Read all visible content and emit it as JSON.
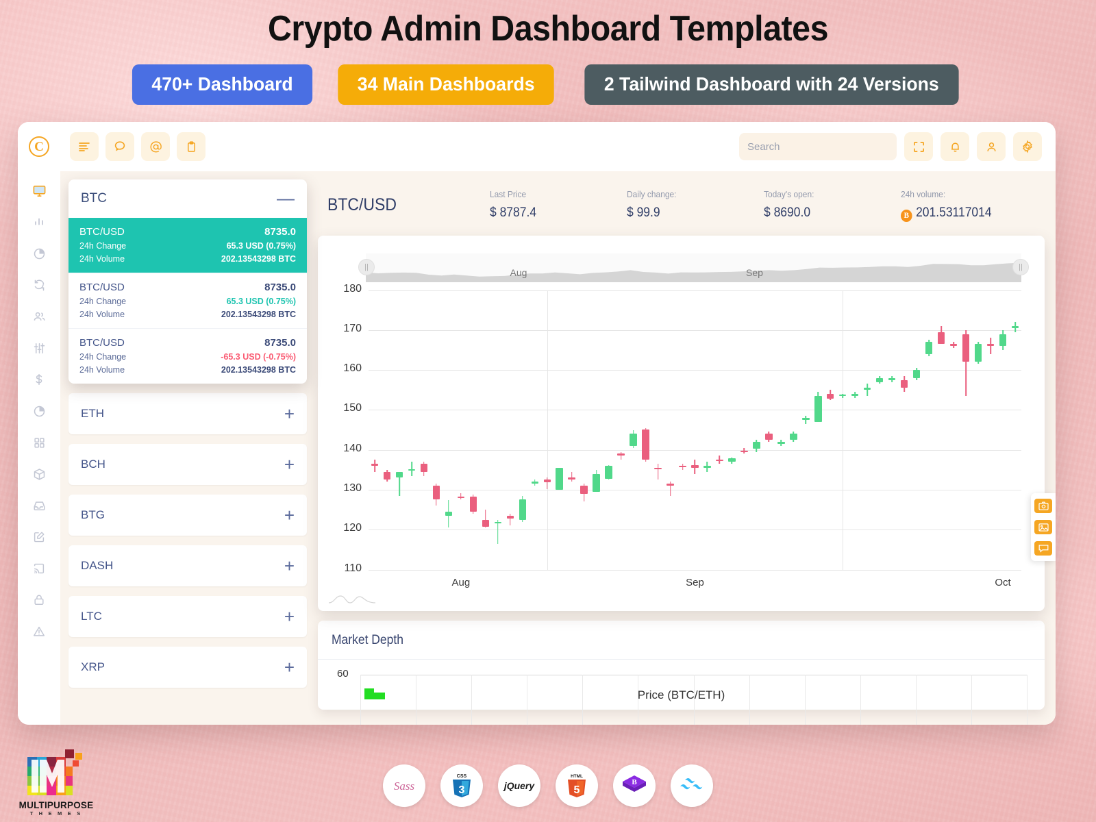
{
  "banner": {
    "title": "Crypto Admin Dashboard Templates",
    "pills": [
      {
        "label": "470+ Dashboard",
        "color": "#4a6fe3"
      },
      {
        "label": "34 Main Dashboards",
        "color": "#f5ac08"
      },
      {
        "label": "2 Tailwind Dashboard with 24 Versions",
        "color": "#4d5c61"
      }
    ]
  },
  "topbar": {
    "logo": "coin-c-logo",
    "left_buttons": [
      {
        "name": "menu-icon",
        "label": ""
      },
      {
        "name": "chat-icon",
        "label": ""
      },
      {
        "name": "mention-icon",
        "label": ""
      },
      {
        "name": "clipboard-icon",
        "label": ""
      }
    ],
    "search": {
      "placeholder": "Search",
      "value": ""
    },
    "right_buttons": [
      {
        "name": "fullscreen-icon"
      },
      {
        "name": "bell-icon"
      },
      {
        "name": "user-icon"
      },
      {
        "name": "gear-icon"
      }
    ]
  },
  "sidebar": {
    "items": [
      {
        "name": "sidebar-item-dashboard",
        "icon": "monitor-icon",
        "active": true
      },
      {
        "name": "sidebar-item-analytics",
        "icon": "bar-chart-icon",
        "active": false
      },
      {
        "name": "sidebar-item-reports",
        "icon": "pie-chart-icon",
        "active": false
      },
      {
        "name": "sidebar-item-exchange",
        "icon": "refresh-icon",
        "active": false
      },
      {
        "name": "sidebar-item-users",
        "icon": "users-icon",
        "active": false
      },
      {
        "name": "sidebar-item-settings-sliders",
        "icon": "sliders-icon",
        "active": false
      },
      {
        "name": "sidebar-item-finance",
        "icon": "dollar-icon",
        "active": false
      },
      {
        "name": "sidebar-item-statistics",
        "icon": "pie-chart-icon",
        "active": false
      },
      {
        "name": "sidebar-item-apps",
        "icon": "grid-icon",
        "active": false
      },
      {
        "name": "sidebar-item-products",
        "icon": "box-icon",
        "active": false
      },
      {
        "name": "sidebar-item-inbox",
        "icon": "inbox-icon",
        "active": false
      },
      {
        "name": "sidebar-item-forms",
        "icon": "edit-icon",
        "active": false
      },
      {
        "name": "sidebar-item-broadcast",
        "icon": "cast-icon",
        "active": false
      },
      {
        "name": "sidebar-item-authentication",
        "icon": "lock-icon",
        "active": false
      },
      {
        "name": "sidebar-item-errors",
        "icon": "warning-icon",
        "active": false
      }
    ]
  },
  "ticker_card": {
    "title": "BTC",
    "collapse_icon": "minus-icon",
    "rows": [
      {
        "selected": true,
        "pair_label": "BTC/USD",
        "price": "8735.0",
        "change_label": "24h Change",
        "change_value": "65.3 USD (0.75%)",
        "change_dir": "up",
        "volume_label": "24h Volume",
        "volume_value": "202.13543298 BTC"
      },
      {
        "selected": false,
        "pair_label": "BTC/USD",
        "price": "8735.0",
        "change_label": "24h Change",
        "change_value": "65.3 USD (0.75%)",
        "change_dir": "up",
        "volume_label": "24h Volume",
        "volume_value": "202.13543298 BTC"
      },
      {
        "selected": false,
        "pair_label": "BTC/USD",
        "price": "8735.0",
        "change_label": "24h Change",
        "change_value": "-65.3 USD (-0.75%)",
        "change_dir": "down",
        "volume_label": "24h Volume",
        "volume_value": "202.13543298 BTC"
      }
    ]
  },
  "coin_list": [
    {
      "symbol": "ETH",
      "action_icon": "plus-icon"
    },
    {
      "symbol": "BCH",
      "action_icon": "plus-icon"
    },
    {
      "symbol": "BTG",
      "action_icon": "plus-icon"
    },
    {
      "symbol": "DASH",
      "action_icon": "plus-icon"
    },
    {
      "symbol": "LTC",
      "action_icon": "plus-icon"
    },
    {
      "symbol": "XRP",
      "action_icon": "plus-icon"
    }
  ],
  "market_header": {
    "pair": "BTC/USD",
    "stats": [
      {
        "label": "Last Price",
        "value": "$ 8787.4"
      },
      {
        "label": "Daily change:",
        "value": "$ 99.9"
      },
      {
        "label": "Today's open:",
        "value": "$ 8690.0"
      },
      {
        "label": "24h volume:",
        "value": "201.53117014",
        "badge": "B"
      }
    ]
  },
  "depth_panel": {
    "title": "Market Depth",
    "y_top": "60",
    "axis_label": "Price (BTC/ETH)"
  },
  "tool_rail": [
    {
      "name": "camera-icon"
    },
    {
      "name": "image-icon"
    },
    {
      "name": "comment-icon"
    }
  ],
  "footer": {
    "logo_name": "MULTIPURPOSE",
    "logo_sub": "T H E M E S",
    "tech": [
      {
        "name": "sass-logo",
        "label": "Sass"
      },
      {
        "name": "css3-logo",
        "label": "CSS3"
      },
      {
        "name": "jquery-logo",
        "label": "jQuery"
      },
      {
        "name": "html5-logo",
        "label": "HTML5"
      },
      {
        "name": "bootstrap-logo",
        "label": "B"
      },
      {
        "name": "tailwind-logo",
        "label": "Tailwind"
      }
    ]
  },
  "chart_data": {
    "type": "candlestick",
    "title": "BTC/USD",
    "xlabel": "",
    "ylabel": "",
    "ylim": [
      110,
      180
    ],
    "yticks": [
      110,
      120,
      130,
      140,
      150,
      160,
      170,
      180
    ],
    "xticks": [
      "Aug",
      "Sep",
      "Oct"
    ],
    "grid": true,
    "navigator": {
      "visible": true,
      "labels": [
        "Aug",
        "Sep"
      ]
    },
    "colors": {
      "up": "#51d88a",
      "down": "#ea5f7e"
    },
    "candles": [
      {
        "o": 136.5,
        "h": 137.5,
        "l": 134.5,
        "c": 136.0,
        "dir": "down"
      },
      {
        "o": 134.5,
        "h": 135.0,
        "l": 132.0,
        "c": 132.5,
        "dir": "down"
      },
      {
        "o": 133.0,
        "h": 134.5,
        "l": 128.5,
        "c": 134.5,
        "dir": "up"
      },
      {
        "o": 135.0,
        "h": 137.0,
        "l": 133.5,
        "c": 135.2,
        "dir": "up"
      },
      {
        "o": 136.5,
        "h": 137.0,
        "l": 133.5,
        "c": 134.5,
        "dir": "down"
      },
      {
        "o": 131.0,
        "h": 131.5,
        "l": 126.0,
        "c": 127.5,
        "dir": "down"
      },
      {
        "o": 123.5,
        "h": 127.5,
        "l": 120.5,
        "c": 124.5,
        "dir": "up"
      },
      {
        "o": 128.2,
        "h": 129.2,
        "l": 127.5,
        "c": 128.0,
        "dir": "down"
      },
      {
        "o": 128.2,
        "h": 128.8,
        "l": 124.0,
        "c": 124.5,
        "dir": "down"
      },
      {
        "o": 122.5,
        "h": 125.0,
        "l": 120.5,
        "c": 120.8,
        "dir": "down"
      },
      {
        "o": 121.8,
        "h": 122.5,
        "l": 116.5,
        "c": 122.0,
        "dir": "up"
      },
      {
        "o": 123.5,
        "h": 124.0,
        "l": 121.0,
        "c": 122.8,
        "dir": "down"
      },
      {
        "o": 122.5,
        "h": 128.5,
        "l": 122.0,
        "c": 127.5,
        "dir": "up"
      },
      {
        "o": 131.5,
        "h": 132.5,
        "l": 131.0,
        "c": 132.0,
        "dir": "up"
      },
      {
        "o": 132.5,
        "h": 133.0,
        "l": 130.2,
        "c": 131.8,
        "dir": "down"
      },
      {
        "o": 130.0,
        "h": 135.5,
        "l": 130.0,
        "c": 135.5,
        "dir": "up"
      },
      {
        "o": 133.0,
        "h": 134.5,
        "l": 132.0,
        "c": 132.5,
        "dir": "down"
      },
      {
        "o": 131.0,
        "h": 131.5,
        "l": 127.0,
        "c": 129.0,
        "dir": "down"
      },
      {
        "o": 129.5,
        "h": 135.0,
        "l": 129.5,
        "c": 134.0,
        "dir": "up"
      },
      {
        "o": 132.8,
        "h": 136.2,
        "l": 132.5,
        "c": 136.0,
        "dir": "up"
      },
      {
        "o": 138.5,
        "h": 139.5,
        "l": 137.5,
        "c": 139.0,
        "dir": "down"
      },
      {
        "o": 141.0,
        "h": 145.0,
        "l": 140.5,
        "c": 144.0,
        "dir": "up"
      },
      {
        "o": 145.0,
        "h": 145.5,
        "l": 137.0,
        "c": 137.5,
        "dir": "down"
      },
      {
        "o": 135.5,
        "h": 136.5,
        "l": 132.5,
        "c": 135.2,
        "dir": "down"
      },
      {
        "o": 131.0,
        "h": 132.0,
        "l": 128.5,
        "c": 131.5,
        "dir": "down"
      },
      {
        "o": 136.0,
        "h": 136.5,
        "l": 135.0,
        "c": 136.0,
        "dir": "down"
      },
      {
        "o": 136.2,
        "h": 137.5,
        "l": 134.0,
        "c": 135.5,
        "dir": "down"
      },
      {
        "o": 135.5,
        "h": 137.0,
        "l": 134.5,
        "c": 136.0,
        "dir": "up"
      },
      {
        "o": 137.5,
        "h": 138.5,
        "l": 136.5,
        "c": 137.2,
        "dir": "down"
      },
      {
        "o": 137.0,
        "h": 138.0,
        "l": 136.5,
        "c": 137.8,
        "dir": "up"
      },
      {
        "o": 139.5,
        "h": 140.5,
        "l": 139.0,
        "c": 139.8,
        "dir": "down"
      },
      {
        "o": 140.2,
        "h": 142.5,
        "l": 139.5,
        "c": 142.0,
        "dir": "up"
      },
      {
        "o": 142.5,
        "h": 144.5,
        "l": 142.0,
        "c": 144.0,
        "dir": "down"
      },
      {
        "o": 141.5,
        "h": 142.5,
        "l": 141.0,
        "c": 142.0,
        "dir": "up"
      },
      {
        "o": 142.5,
        "h": 144.5,
        "l": 142.0,
        "c": 144.0,
        "dir": "up"
      },
      {
        "o": 147.5,
        "h": 148.5,
        "l": 146.5,
        "c": 148.0,
        "dir": "up"
      },
      {
        "o": 147.0,
        "h": 154.5,
        "l": 147.0,
        "c": 153.5,
        "dir": "up"
      },
      {
        "o": 154.0,
        "h": 155.0,
        "l": 152.5,
        "c": 152.8,
        "dir": "down"
      },
      {
        "o": 153.5,
        "h": 154.0,
        "l": 153.0,
        "c": 153.8,
        "dir": "up"
      },
      {
        "o": 153.5,
        "h": 154.5,
        "l": 153.0,
        "c": 154.0,
        "dir": "up"
      },
      {
        "o": 155.0,
        "h": 156.5,
        "l": 153.5,
        "c": 155.5,
        "dir": "up"
      },
      {
        "o": 157.0,
        "h": 158.5,
        "l": 156.5,
        "c": 158.0,
        "dir": "up"
      },
      {
        "o": 157.5,
        "h": 158.5,
        "l": 157.0,
        "c": 158.0,
        "dir": "up"
      },
      {
        "o": 157.5,
        "h": 158.5,
        "l": 154.5,
        "c": 155.5,
        "dir": "down"
      },
      {
        "o": 158.0,
        "h": 160.5,
        "l": 157.5,
        "c": 160.0,
        "dir": "up"
      },
      {
        "o": 164.0,
        "h": 167.5,
        "l": 163.5,
        "c": 167.0,
        "dir": "up"
      },
      {
        "o": 169.5,
        "h": 171.0,
        "l": 166.5,
        "c": 166.5,
        "dir": "down"
      },
      {
        "o": 166.5,
        "h": 167.0,
        "l": 165.5,
        "c": 166.0,
        "dir": "down"
      },
      {
        "o": 169.0,
        "h": 170.0,
        "l": 153.5,
        "c": 162.0,
        "dir": "down"
      },
      {
        "o": 166.5,
        "h": 167.0,
        "l": 161.5,
        "c": 162.0,
        "dir": "up"
      },
      {
        "o": 166.5,
        "h": 168.0,
        "l": 164.0,
        "c": 166.0,
        "dir": "down"
      },
      {
        "o": 166.0,
        "h": 170.0,
        "l": 165.0,
        "c": 169.0,
        "dir": "up"
      },
      {
        "o": 170.5,
        "h": 172.0,
        "l": 169.5,
        "c": 171.0,
        "dir": "up"
      }
    ]
  }
}
